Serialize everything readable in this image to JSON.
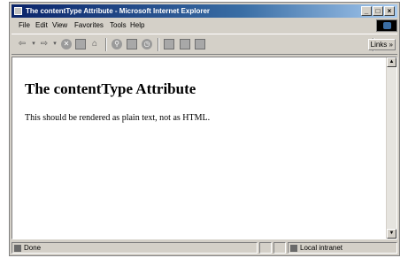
{
  "window": {
    "title": "The contentType Attribute - Microsoft Internet Explorer",
    "controls": {
      "minimize": "_",
      "maximize": "□",
      "close": "×"
    }
  },
  "menu": [
    "File",
    "Edit",
    "View",
    "Favorites",
    "Tools",
    "Help"
  ],
  "toolbar": {
    "buttons": [
      "back-icon",
      "forward-icon",
      "stop-icon",
      "refresh-icon",
      "home-icon",
      "search-icon",
      "favorites-icon",
      "history-icon",
      "mail-icon",
      "print-icon",
      "edit-icon"
    ],
    "links_label": "Links",
    "links_chevron": "»"
  },
  "page": {
    "heading": "The contentType Attribute",
    "paragraph": "This should be rendered as plain text, not as HTML."
  },
  "status": {
    "left_text": "Done",
    "zone_text": "Local intranet"
  }
}
